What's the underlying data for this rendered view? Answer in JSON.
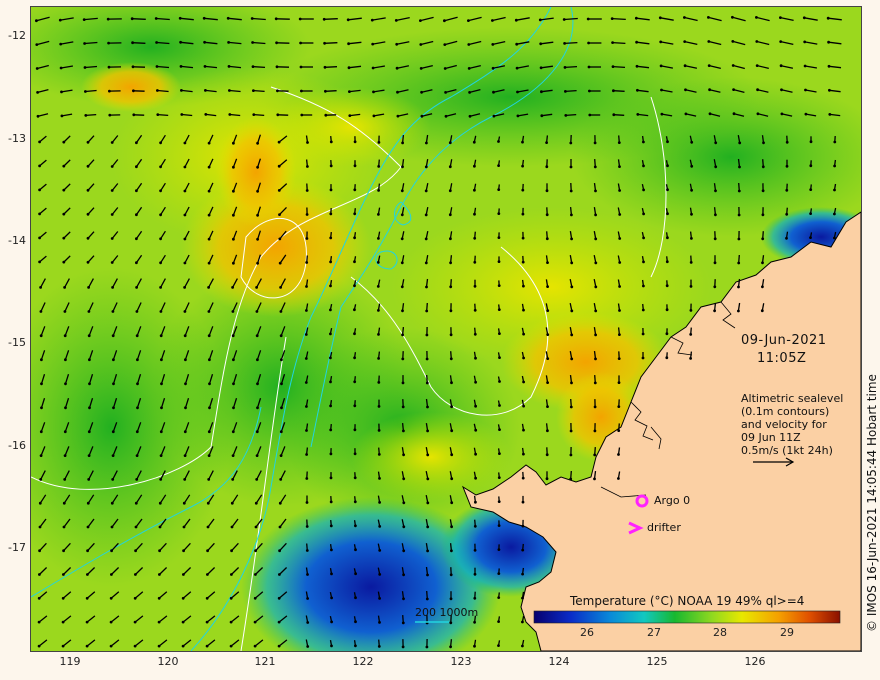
{
  "map": {
    "lat_ticks": [
      "-12",
      "-13",
      "-14",
      "-15",
      "-16",
      "-17"
    ],
    "lon_ticks": [
      "119",
      "120",
      "121",
      "122",
      "123",
      "124",
      "125",
      "126"
    ],
    "lat_range": [
      -12,
      -17
    ],
    "lon_range": [
      119,
      126
    ],
    "colors": {
      "land": "#fbd0a4",
      "sst_cool": "#1a2fb0",
      "sst_warm": "#f5a000",
      "contour_isobath": "#22d4e0",
      "contour_sealevel": "#ffffff",
      "argo_marker": "#ff22ff",
      "drifter_marker": "#ff22ff"
    }
  },
  "info": {
    "date": "09-Jun-2021",
    "time": "11:05Z",
    "altimetry_line1": "Altimetric sealevel",
    "altimetry_line2": "(0.1m contours)",
    "altimetry_line3": "and velocity for",
    "altimetry_line4": "09 Jun 11Z",
    "velocity_scale": "0.5m/s (1kt 24h)"
  },
  "legend": {
    "argo": "Argo 0",
    "drifter": "drifter",
    "isobath": "200  1000m"
  },
  "colorbar": {
    "title": "Temperature (°C) NOAA 19 49% ql>=4",
    "ticks": [
      "26",
      "27",
      "28",
      "29"
    ],
    "tick_values": [
      26,
      27,
      28,
      29
    ],
    "range": [
      25.2,
      29.8
    ]
  },
  "copyright": "© IMOS 16-Jun-2021 14:05:44 Hobart time"
}
